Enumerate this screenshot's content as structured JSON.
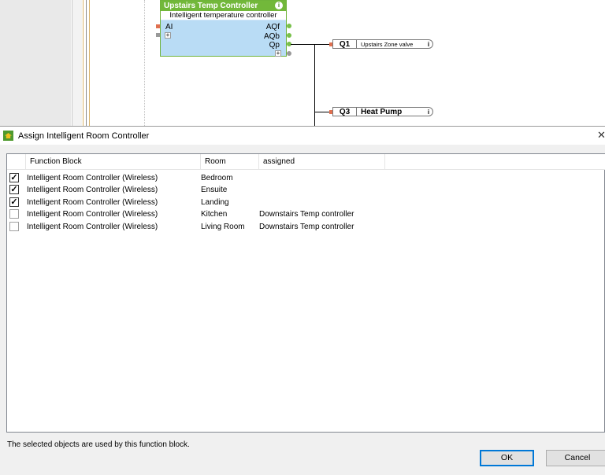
{
  "diagram": {
    "function_block": {
      "title": "Upstairs Temp Controller",
      "info_icon": "i",
      "subtitle": "Intelligent temperature controller",
      "inputs": [
        "AI",
        "+"
      ],
      "outputs": [
        "AQf",
        "AQb",
        "Qp",
        "+"
      ]
    },
    "output_blocks": [
      {
        "id": "Q1",
        "name": "Upstairs Zone valve",
        "info": "i"
      },
      {
        "id": "Q3",
        "name": "Heat Pump",
        "info": "i"
      }
    ]
  },
  "dialog": {
    "title": "Assign Intelligent Room Controller",
    "close_label": "✕",
    "columns": [
      "Function Block",
      "Room",
      "assigned"
    ],
    "rows": [
      {
        "checked": true,
        "checkmark": "✓",
        "function_block": "Intelligent Room Controller (Wireless)",
        "room": "Bedroom",
        "assigned": ""
      },
      {
        "checked": true,
        "checkmark": "✓",
        "function_block": "Intelligent Room Controller (Wireless)",
        "room": "Ensuite",
        "assigned": ""
      },
      {
        "checked": true,
        "checkmark": "✓",
        "function_block": "Intelligent Room Controller (Wireless)",
        "room": "Landing",
        "assigned": ""
      },
      {
        "checked": false,
        "checkmark": "",
        "function_block": "Intelligent Room Controller (Wireless)",
        "room": "Kitchen",
        "assigned": "Downstairs Temp controller"
      },
      {
        "checked": false,
        "checkmark": "",
        "function_block": "Intelligent Room Controller (Wireless)",
        "room": "Living Room",
        "assigned": "Downstairs Temp controller"
      }
    ],
    "status_text": "The selected objects are used by this function block.",
    "ok_label": "OK",
    "cancel_label": "Cancel"
  },
  "colors": {
    "block_header": "#72b83a",
    "block_body": "#b9dcf5",
    "button_focus": "#0078d7"
  }
}
